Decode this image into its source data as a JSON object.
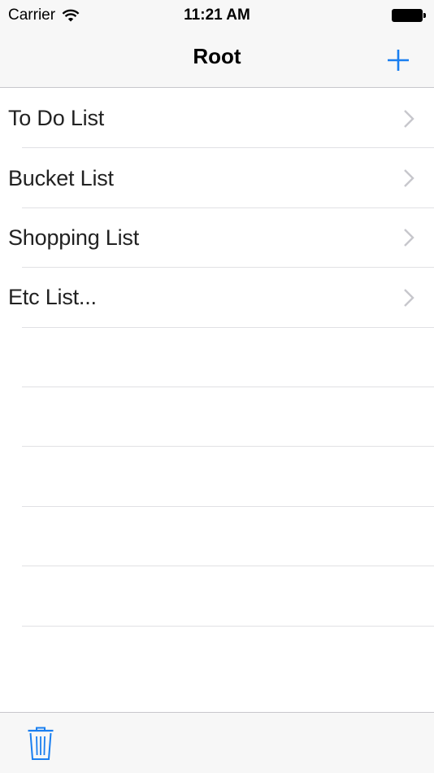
{
  "status_bar": {
    "carrier": "Carrier",
    "time": "11:21 AM",
    "wifi_icon": "wifi-icon",
    "battery_icon": "battery-full-icon"
  },
  "nav_bar": {
    "title": "Root",
    "add_icon": "plus-icon"
  },
  "table": {
    "rows": [
      {
        "label": "To Do List"
      },
      {
        "label": "Bucket List"
      },
      {
        "label": "Shopping List"
      },
      {
        "label": "Etc List..."
      }
    ],
    "empty_row_count": 6,
    "accessory_icon": "chevron-right-icon"
  },
  "toolbar": {
    "trash_icon": "trash-icon"
  },
  "colors": {
    "tint": "#1a7ff0",
    "chrome_bg": "#f7f7f7",
    "separator": "#e1e1e4",
    "chevron": "#c7c7cc"
  }
}
